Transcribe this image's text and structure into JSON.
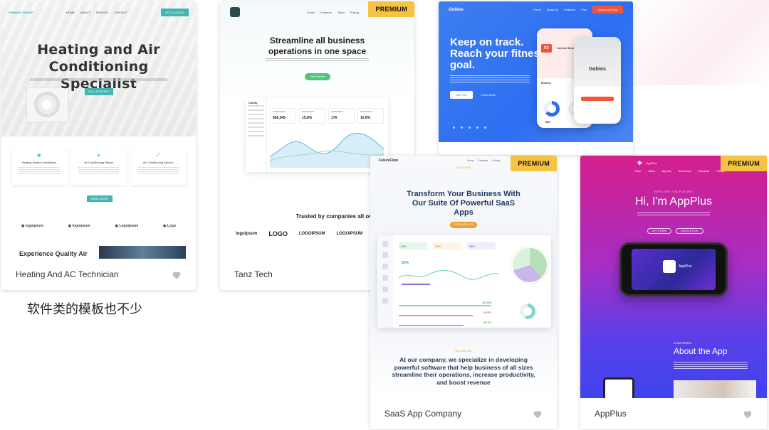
{
  "caption": "软件类的模板也不少",
  "cards": [
    {
      "name": "Heating And AC Technician",
      "premium": false,
      "thumb": {
        "brand": "PRIMARY GROUP",
        "nav": [
          "HOME",
          "ABOUT",
          "SERVICE",
          "CONTACT"
        ],
        "nav_button": "GET A QUOTE",
        "headline": "Heating and Air Conditioning Specialist",
        "cta": "CALL FOR INFO",
        "features": [
          {
            "icon": "snowflake-icon",
            "title": "Heating System Installation"
          },
          {
            "icon": "fan-icon",
            "title": "Air Conditioning Repair"
          },
          {
            "icon": "wrench-icon",
            "title": "Air Conditioning Service"
          }
        ],
        "read_more": "READ MORE",
        "logos": [
          "logoipsum",
          "logoipsum",
          "Logoipsum",
          "Logo"
        ],
        "bottom_heading": "Experience Quality Air"
      }
    },
    {
      "name": "Tanz Tech",
      "premium": true,
      "thumb": {
        "nav": [
          "Home",
          "Features",
          "Team",
          "Pricing"
        ],
        "headline": "Streamline all business operations in one space",
        "cta": "Get Started",
        "dash_brand": "Clarity",
        "stats": [
          "$56,545",
          "15.8%",
          "176",
          "15.8%"
        ],
        "trusted": "Trusted by companies all over the world",
        "logos": [
          "logoipsum",
          "LOGO",
          "LOGOIPSUM",
          "LOGOIPSUM"
        ]
      }
    },
    {
      "name": "Gobios",
      "premium": false,
      "thumb": {
        "brand": "Gobios",
        "nav": [
          "Home",
          "About Us",
          "Features",
          "Plan"
        ],
        "nav_button": "Download Now",
        "headline": "Keep on track. Reach your fitness goal.",
        "btn1": "Get Free",
        "btn2": "Learn More",
        "score": "92",
        "score_label": "Current Score",
        "metrics_label": "Metrics",
        "phone_brand": "Gobios",
        "stat": "589"
      }
    },
    {
      "name": "SaaS App Company",
      "premium": true,
      "thumb": {
        "brand": "FutureFlow",
        "nav": [
          "Home",
          "Features",
          "Pricing"
        ],
        "tag": "SOLUTIONS",
        "headline": "Transform Your Business With Our Suite Of Powerful SaaS Apps",
        "cta": "PURCHASE NOW",
        "pills": [
          "25%",
          "15%",
          "25%"
        ],
        "chart_value": "35%",
        "row_values": [
          "$3,300",
          "29.6%",
          "35.7%"
        ],
        "tag2": "WHO WE ARE",
        "paragraph": "At our company, we specialize in developing powerful software that help business of all sizes streamline their operations, increase productivity, and boost revenue"
      }
    },
    {
      "name": "AppPlus",
      "premium": true,
      "thumb": {
        "brand": "AppPlus",
        "nav": [
          "Home",
          "About",
          "App Info",
          "Screenshot",
          "Download",
          "Pricing"
        ],
        "tag": "EXPLORE THE FUTURE",
        "headline": "Hi, I'm AppPlus",
        "btn1": "APP STORE",
        "btn2": "GOOGLE PLAY",
        "app_label": "AppPlus",
        "tag2": "A FEW WORDS",
        "h2": "About the App"
      }
    }
  ],
  "premium_label": "PREMIUM"
}
